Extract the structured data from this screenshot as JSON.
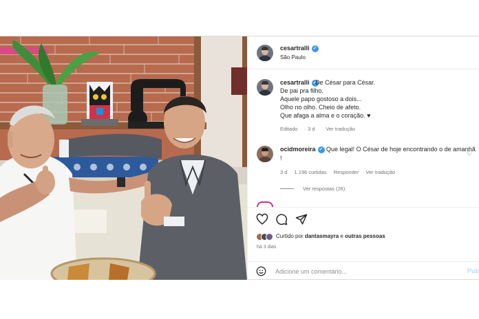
{
  "post": {
    "author": {
      "username": "cesartralli",
      "verified": true,
      "location": "São Paulo"
    },
    "caption": {
      "username": "cesartralli",
      "text": "De César para César.\nDe pai pra filho.\nAquele papo gostoso a dois...\nOlho no olho. Cheio de afeto.\nQue afaga a alma e o coração. ♥",
      "edited_label": "Editado",
      "age": "3 d",
      "translate_label": "Ver tradução"
    },
    "comments": [
      {
        "username": "ocidmoreira",
        "verified": true,
        "text": "Que legal! O César de hoje encontrando o de amanhã !",
        "age": "3 d",
        "likes": "1.196 curtidas",
        "reply_label": "Responder",
        "translate_label": "Ver tradução",
        "replies_label": "Ver respostas (26)"
      }
    ],
    "likes": {
      "prefix": "Curtido por",
      "user": "dantasmayra",
      "connector": "e",
      "others": "outras pessoas"
    },
    "date": "há 3 dias",
    "add_comment": {
      "placeholder": "Adicione um comentário...",
      "publish_label": "Publicar"
    },
    "icons": {
      "like": "heart-icon",
      "comment": "comment-icon",
      "share": "share-icon",
      "emoji": "emoji-icon",
      "verified": "verified-badge-icon"
    },
    "colors": {
      "verified": "#3897f0",
      "publish_disabled": "#b3dbff",
      "secondary_text": "#737373"
    }
  }
}
